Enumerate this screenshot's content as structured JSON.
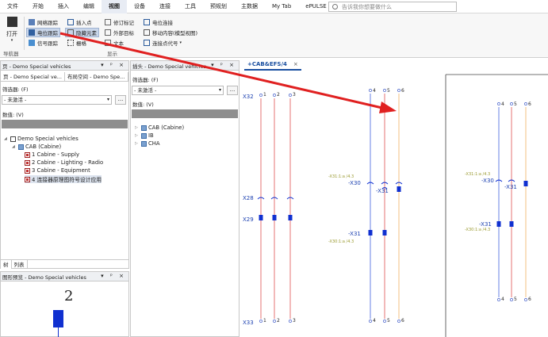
{
  "menu": {
    "items": [
      "文件",
      "开始",
      "插入",
      "编辑",
      "视图",
      "设备",
      "连接",
      "工具",
      "预规划",
      "主数据",
      "My Tab",
      "ePULSE"
    ],
    "active": "视图",
    "search_placeholder": "告诉我你想要做什么"
  },
  "ribbon": {
    "open_label": "打开",
    "navigator_group": "导航器",
    "display_group": "显示",
    "buttons": {
      "network_trace": "网络跟踪",
      "potential_trace": "电位跟踪",
      "signal_trace": "信号跟踪",
      "insert_point": "插入点",
      "hidden_elements": "隐藏元素",
      "grid": "栅格",
      "revision_marks": "修订标记",
      "outer_target": "外部目标",
      "text_placeholder": "文本",
      "potential_connection": "电位连接",
      "move_content": "移动内容(模型视图)",
      "connection_code": "连接点代号"
    }
  },
  "page_panel": {
    "title": "页 - Demo Special vehicles",
    "tabs": [
      "页 - Demo Special ve...",
      "布局空间 - Demo Spe..."
    ],
    "filter_label": "筛选器: (F)",
    "filter_value": "- 未激活 -",
    "value_label": "数值: (V)",
    "tree": [
      {
        "label": "Demo Special vehicles",
        "level": 0,
        "icon": "project-icon"
      },
      {
        "label": "CAB (Cabine)",
        "level": 1,
        "icon": "folder-icon"
      },
      {
        "label": "1 Cabine - Supply",
        "level": 2,
        "icon": "page-icon"
      },
      {
        "label": "2 Cabine - Lighting - Radio",
        "level": 2,
        "icon": "page-icon"
      },
      {
        "label": "3 Cabine - Equipment",
        "level": 2,
        "icon": "page-icon"
      },
      {
        "label": "4 连接器原理图符号设计应用",
        "level": 2,
        "icon": "page-icon",
        "selected": true
      }
    ],
    "bottom_tabs": [
      "树",
      "列表"
    ]
  },
  "plug_panel": {
    "title": "插头 - Demo Special vehicles",
    "filter_label": "筛选器: (F)",
    "filter_value": "- 未激活 -",
    "value_label": "数值: (V)",
    "tree": [
      "CAB (Cabine)",
      "IB",
      "CHA"
    ]
  },
  "preview_panel": {
    "title": "图形预览 - Demo Special vehicles",
    "number": "2"
  },
  "document": {
    "tab_label": "+CAB&EFS/4",
    "labels": {
      "x32": "X32",
      "x28": "X28",
      "x29": "X29",
      "x33": "X33",
      "x30": "-X30",
      "x31": "-X31",
      "ref_x31": "-X31:1:a /4.3",
      "ref_x30": "-X30:1:a /4.3"
    },
    "pins": [
      "1",
      "2",
      "3",
      "4",
      "5",
      "6"
    ]
  },
  "colors": {
    "wire_red": "#e05050",
    "wire_blue": "#4060e0",
    "wire_orange": "#f0b060",
    "arrow": "#e02020",
    "symbol": "#1030d0",
    "label_green": "#9a9a30"
  }
}
